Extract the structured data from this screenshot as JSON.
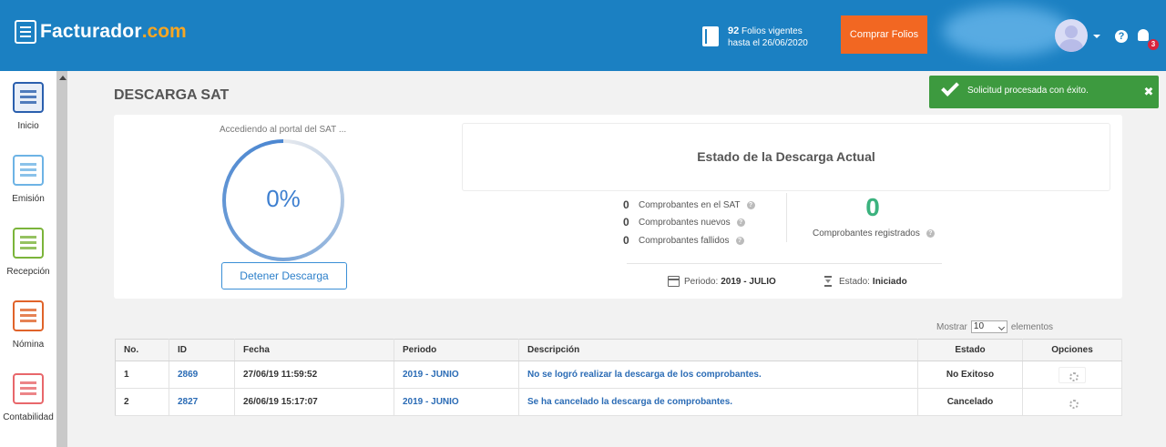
{
  "header": {
    "logo_text": "Facturador",
    "logo_suffix": ".com",
    "folios_count": "92",
    "folios_label": "Folios vigentes",
    "folios_until": "hasta el 26/06/2020",
    "buy_button": "Comprar Folios",
    "notification_count": "3"
  },
  "sidebar": {
    "items": [
      {
        "label": "Inicio",
        "icon": "dashboard-icon",
        "color": "#2a5fae"
      },
      {
        "label": "Emisión",
        "icon": "invoice-out-icon",
        "color": "#6db3e5"
      },
      {
        "label": "Recepción",
        "icon": "invoice-in-icon",
        "color": "#7bb43a"
      },
      {
        "label": "Nómina",
        "icon": "payroll-icon",
        "color": "#e0632a"
      },
      {
        "label": "Contabilidad",
        "icon": "calculator-icon",
        "color": "#e8676b"
      }
    ]
  },
  "page": {
    "title": "DESCARGA SAT"
  },
  "progress": {
    "portal_text": "Accediendo al portal del SAT ...",
    "percent_label": "0%",
    "percent": 0,
    "stop_button": "Detener Descarga"
  },
  "status": {
    "title": "Estado de la Descarga Actual",
    "stats": [
      {
        "value": "0",
        "label": "Comprobantes en el SAT"
      },
      {
        "value": "0",
        "label": "Comprobantes nuevos"
      },
      {
        "value": "0",
        "label": "Comprobantes fallidos"
      }
    ],
    "registered_value": "0",
    "registered_label": "Comprobantes registrados",
    "period_label": "Periodo:",
    "period_value": "2019 - JULIO",
    "state_label": "Estado:",
    "state_value": "Iniciado"
  },
  "table": {
    "show_label": "Mostrar",
    "show_value": "10",
    "show_suffix": "elementos",
    "headers": [
      "No.",
      "ID",
      "Fecha",
      "Periodo",
      "Descripción",
      "Estado",
      "Opciones"
    ],
    "rows": [
      {
        "no": "1",
        "id": "2869",
        "fecha": "27/06/19 11:59:52",
        "periodo": "2019 - JUNIO",
        "descripcion": "No se logró realizar la descarga de los comprobantes.",
        "estado": "No Exitoso"
      },
      {
        "no": "2",
        "id": "2827",
        "fecha": "26/06/19 15:17:07",
        "periodo": "2019 - JUNIO",
        "descripcion": "Se ha cancelado la descarga de comprobantes.",
        "estado": "Cancelado"
      }
    ]
  },
  "toast": {
    "message": "Solicitud procesada con éxito.",
    "close": "✖"
  }
}
